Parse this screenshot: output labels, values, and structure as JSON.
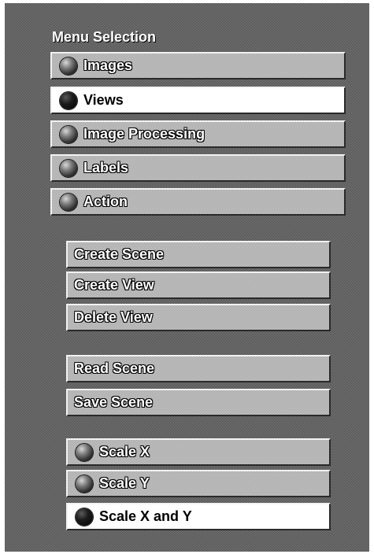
{
  "menu": {
    "title": "Menu Selection",
    "items": [
      {
        "label": "Images",
        "selected": false
      },
      {
        "label": "Views",
        "selected": true
      },
      {
        "label": "Image Processing",
        "selected": false
      },
      {
        "label": "Labels",
        "selected": false
      },
      {
        "label": "Action",
        "selected": false
      }
    ]
  },
  "view_commands": [
    {
      "label": "Create Scene"
    },
    {
      "label": "Create View"
    },
    {
      "label": "Delete View"
    }
  ],
  "scene_commands": [
    {
      "label": "Read Scene"
    },
    {
      "label": "Save Scene"
    }
  ],
  "scale_options": [
    {
      "label": "Scale X",
      "selected": false
    },
    {
      "label": "Scale Y",
      "selected": false
    },
    {
      "label": "Scale X and Y",
      "selected": true
    }
  ]
}
